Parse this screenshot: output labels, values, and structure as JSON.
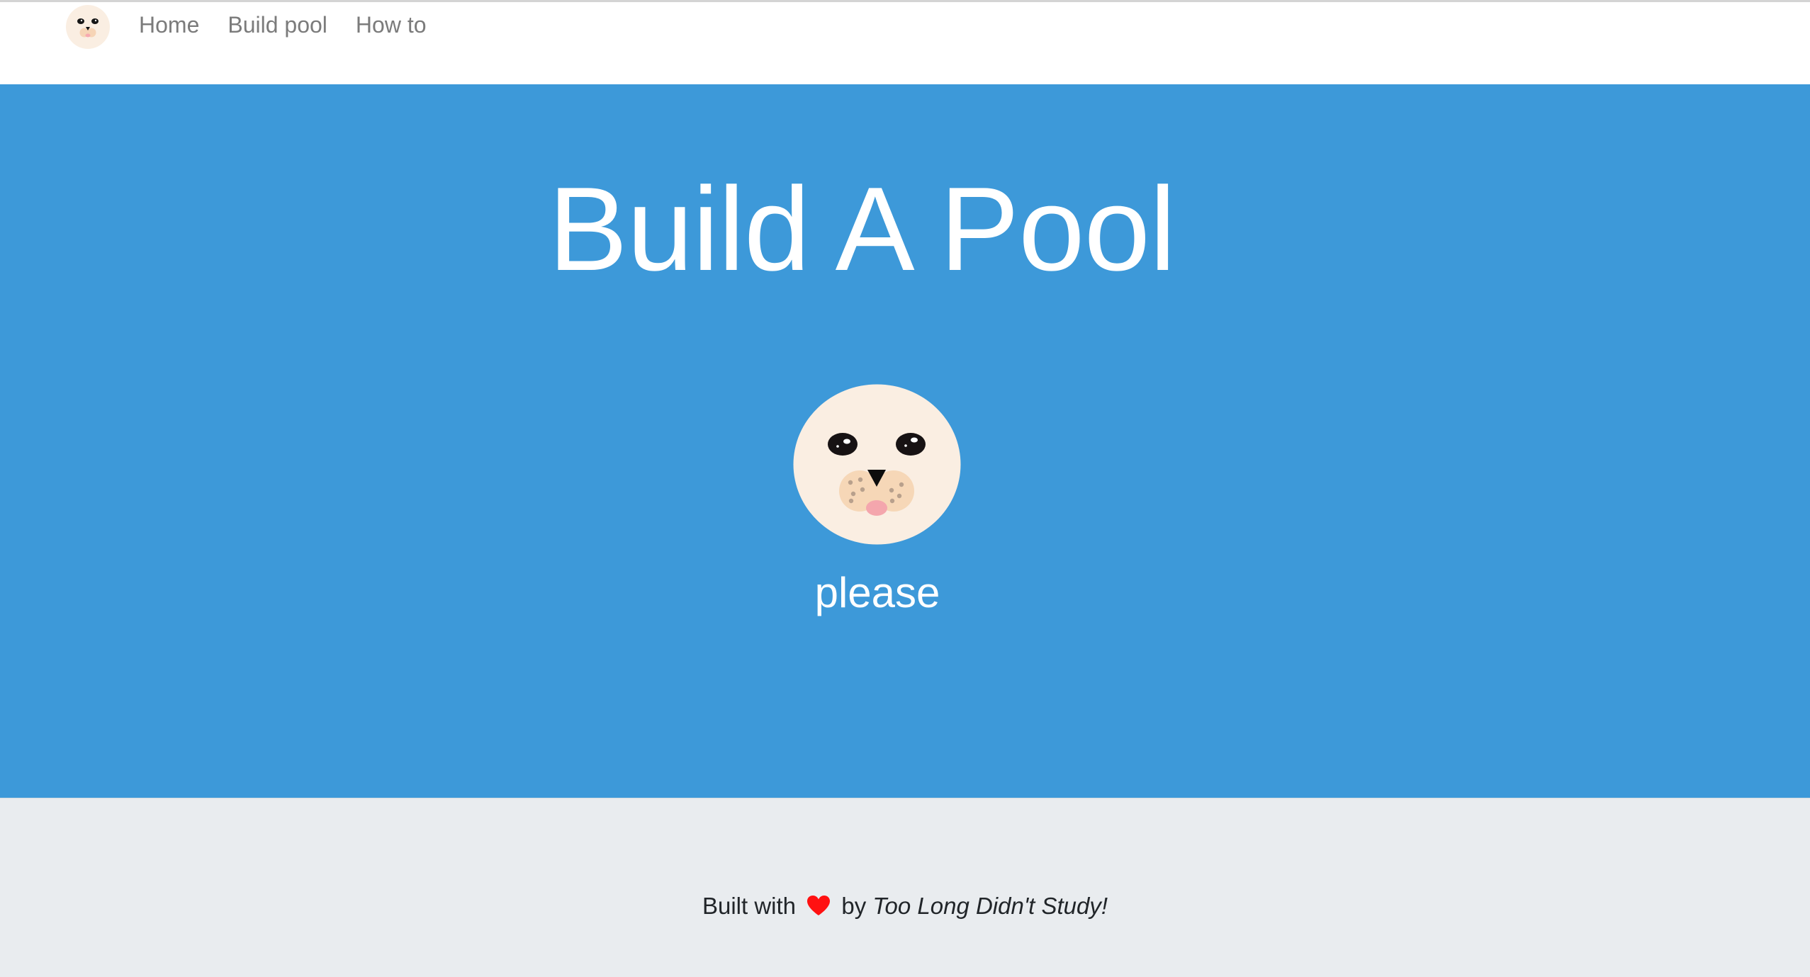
{
  "navbar": {
    "logo_icon": "seal-face-icon",
    "links": [
      {
        "label": "Home"
      },
      {
        "label": "Build pool"
      },
      {
        "label": "How to"
      }
    ]
  },
  "hero": {
    "title": "Build A Pool",
    "seal_icon": "seal-face-icon",
    "caption": "please",
    "background_color": "#3d99d9"
  },
  "footer": {
    "prefix": "Built with",
    "heart_icon": "heart-icon",
    "by": "by",
    "team": "Too Long Didn't Study!",
    "background_color": "#e9ecef"
  }
}
